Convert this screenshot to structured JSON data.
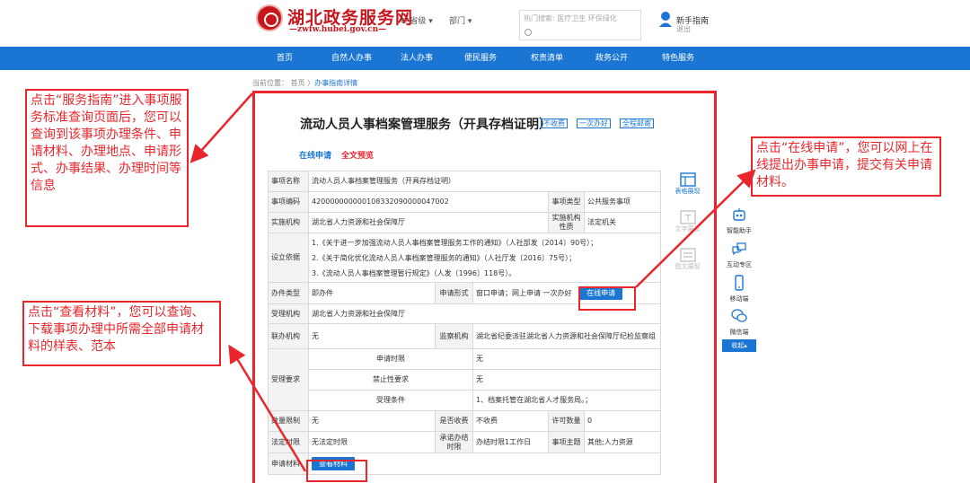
{
  "header": {
    "logo_title": "湖北政务服务网",
    "logo_url": "—zwfw.hubei.gov.cn—",
    "region": "省级",
    "dept": "部门",
    "search_hint": "热门搜索: 医疗卫生 环保绿化",
    "user_link1": "新手指南",
    "user_link2": "退出"
  },
  "nav": [
    "首页",
    "自然人办事",
    "法人办事",
    "便民服务",
    "权责清单",
    "政务公开",
    "特色服务"
  ],
  "breadcrumb": {
    "prefix": "当前位置： 首页",
    "current": "办事指南详情"
  },
  "service": {
    "title": "流动人员人事档案管理服务（开具存档证明）",
    "tags": [
      "不收费",
      "一次办好",
      "全程邮寄"
    ],
    "online_apply": "在线申请",
    "full_preview": "全文预览"
  },
  "table": {
    "item_name_label": "事项名称",
    "item_name": "流动人员人事档案管理服务（开具存档证明）",
    "item_code_label": "事项编码",
    "item_code": "420000000000108332090000047002",
    "item_type_label": "事项类型",
    "item_type": "公共服务事项",
    "org_label": "实施机构",
    "org": "湖北省人力资源和社会保障厅",
    "org_nature_label": "实施机构性质",
    "org_nature": "法定机关",
    "basis_label": "设立依据",
    "basis": [
      "1.《关于进一步加强流动人员人事档案管理服务工作的通知》（人社部发〔2014〕90号）；",
      "2.《关于简化优化流动人员人事档案管理服务的通知》（人社厅发〔2016〕75号）；",
      "3.《流动人员人事档案管理暂行规定》（人发〔1996〕118号）。"
    ],
    "handle_type_label": "办件类型",
    "handle_type": "即办件",
    "apply_form_label": "申请形式",
    "apply_form": "窗口申请；网上申请 一次办好",
    "online_btn": "在线申请",
    "accept_org_label": "受理机构",
    "accept_org": "湖北省人力资源和社会保障厅",
    "joint_org_label": "联办机构",
    "joint_org": "无",
    "supervise_label": "监察机构",
    "supervise": "湖北省纪委派驻湖北省人力资源和社会保障厅纪检监察组",
    "accept_req_label": "受理要求",
    "time_limit_label": "申请时限",
    "time_limit": "无",
    "forbid_label": "禁止性要求",
    "forbid": "无",
    "condition_label": "受理条件",
    "condition": "1、档案托管在湖北省人才服务局。；",
    "qty_limit_label": "数量限制",
    "qty_limit": "无",
    "fee_label": "是否收费",
    "fee": "不收费",
    "permit_qty_label": "许可数量",
    "permit_qty": "0",
    "legal_time_label": "法定时限",
    "legal_time": "无法定时限",
    "promise_label": "承诺办结时限",
    "promise": "办结时限1工作日",
    "topic_label": "事项主题",
    "topic": "其他;人力资源",
    "material_label": "申请材料",
    "material_btn": "查看材料"
  },
  "view_modes": [
    "表格展现",
    "文字展现",
    "图文展现"
  ],
  "side_panel": [
    "智能助手",
    "互动专区",
    "移动端",
    "微信端",
    "收起"
  ],
  "annotations": {
    "left_top": "点击“服务指南”进入事项服务标准查询页面后，您可以查询到该事项办理条件、申请材料、办理地点、申请形式、办事结果、办理时间等信息",
    "left_bottom": "点击“查看材料”，您可以查询、下载事项办理中所需全部申请材料的样表、范本",
    "right": "点击“在线申请”，您可以网上在线提出办事申请，提交有关申请材料。"
  },
  "colors": {
    "brand_red": "#c8161d",
    "nav_blue": "#1a76d2",
    "annotation_red": "#e8262c"
  }
}
